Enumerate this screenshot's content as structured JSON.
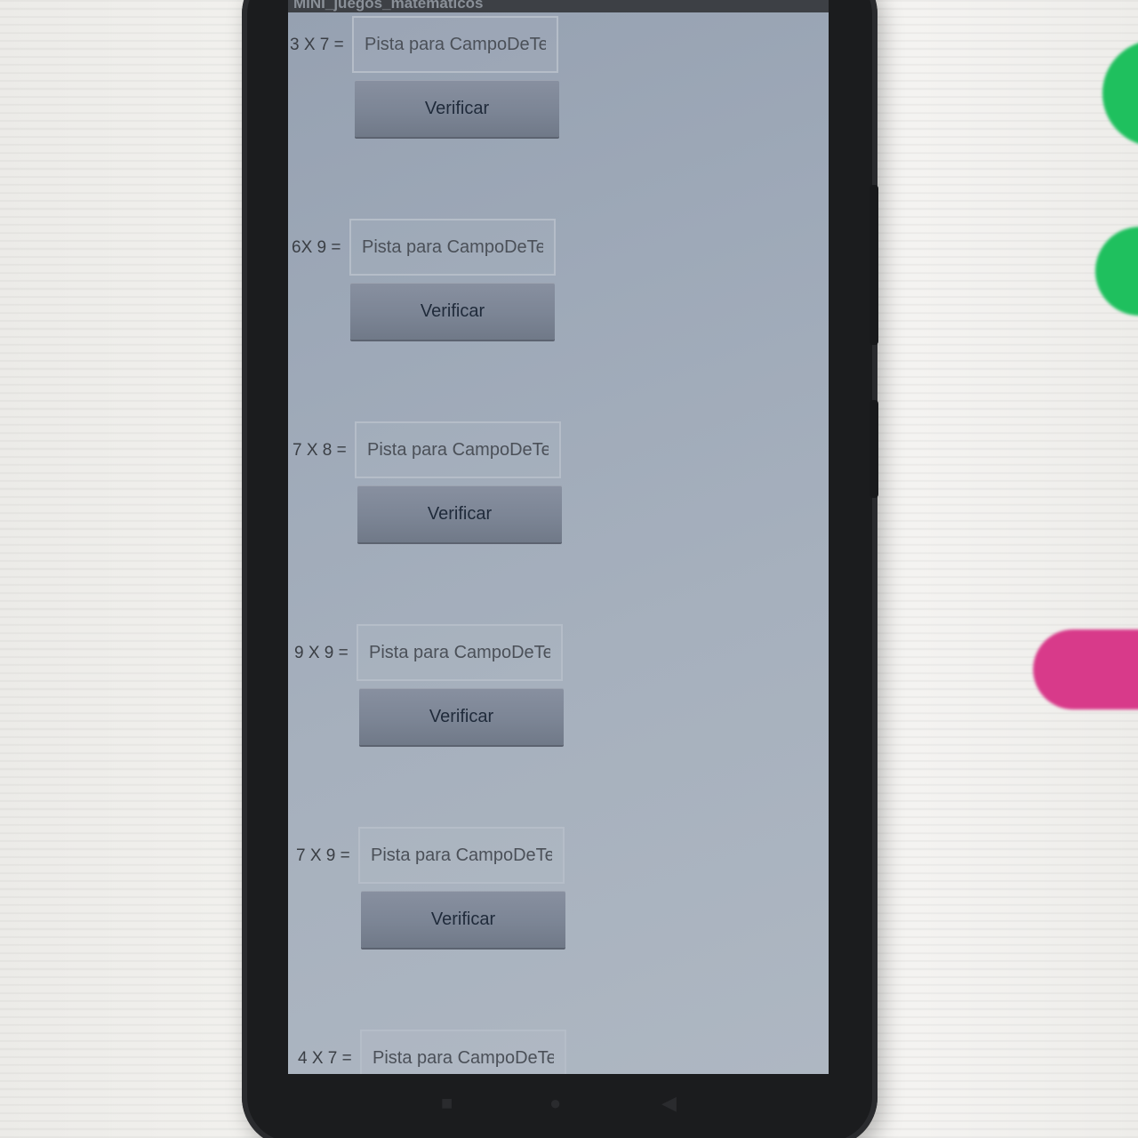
{
  "app": {
    "title": "MINI_juegos_matematicos"
  },
  "rows": [
    {
      "label": "3 X 7 =",
      "placeholder": "Pista para CampoDeTe",
      "button_label": "Verificar"
    },
    {
      "label": "6X 9 =",
      "placeholder": "Pista para CampoDeTe",
      "button_label": "Verificar"
    },
    {
      "label": "7 X 8 =",
      "placeholder": "Pista para CampoDeTe",
      "button_label": "Verificar"
    },
    {
      "label": "9 X 9 =",
      "placeholder": "Pista para CampoDeTe",
      "button_label": "Verificar"
    },
    {
      "label": "7 X 9 =",
      "placeholder": "Pista para CampoDeTe",
      "button_label": "Verificar"
    },
    {
      "label": "4 X 7 =",
      "placeholder": "Pista para CampoDeTe"
    }
  ],
  "nav": {
    "icons": [
      "recent-apps-icon",
      "home-icon",
      "back-icon"
    ]
  },
  "colors": {
    "screen": "#a3adba",
    "button": "#7c8595",
    "button_text": "#1f2a3a",
    "phone_body": "#1b1c1e"
  }
}
